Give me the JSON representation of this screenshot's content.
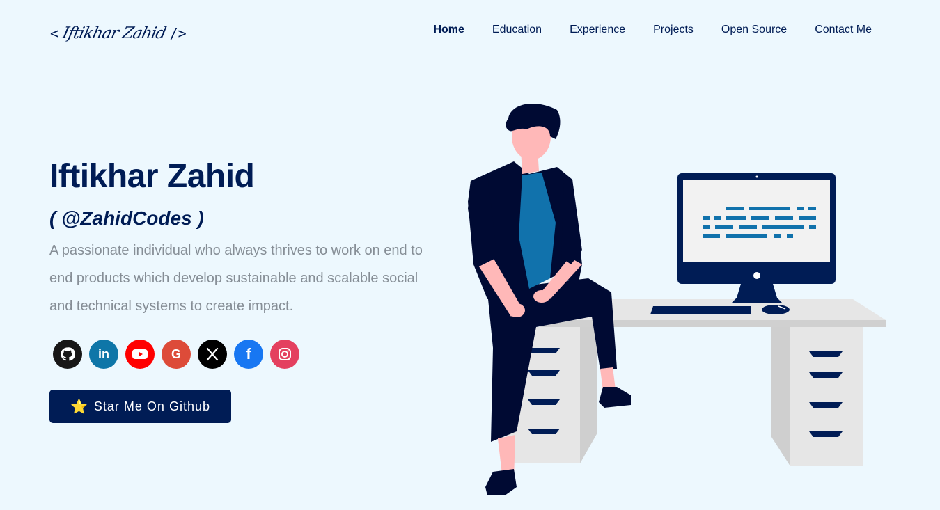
{
  "logo": {
    "open": "<",
    "signature": "Iftikhar Zahid",
    "close": "/>"
  },
  "nav": [
    {
      "label": "Home"
    },
    {
      "label": "Education"
    },
    {
      "label": "Experience"
    },
    {
      "label": "Projects"
    },
    {
      "label": "Open Source"
    },
    {
      "label": "Contact Me"
    }
  ],
  "hero": {
    "name": "Iftikhar Zahid",
    "handle": "( @ZahidCodes )",
    "bio": "A passionate individual who always thrives to work on end to end products which develop sustainable and scalable social and technical systems to create impact.",
    "cta_label": "Star Me On Github",
    "cta_icon": "⭐"
  },
  "socials": [
    {
      "name": "github-icon",
      "glyph": "",
      "color": "#181717"
    },
    {
      "name": "linkedin-icon",
      "glyph": "in",
      "color": "#0e76a8"
    },
    {
      "name": "youtube-icon",
      "glyph": "▶",
      "color": "#ff0000"
    },
    {
      "name": "google-icon",
      "glyph": "G",
      "color": "#dd4b39"
    },
    {
      "name": "x-icon",
      "glyph": "X",
      "color": "#000000"
    },
    {
      "name": "facebook-icon",
      "glyph": "f",
      "color": "#1877f2"
    },
    {
      "name": "instagram-icon",
      "glyph": "",
      "color": "#e4405f"
    }
  ],
  "colors": {
    "background": "#edf8fe",
    "primary": "#001c55",
    "muted": "#868e96"
  }
}
